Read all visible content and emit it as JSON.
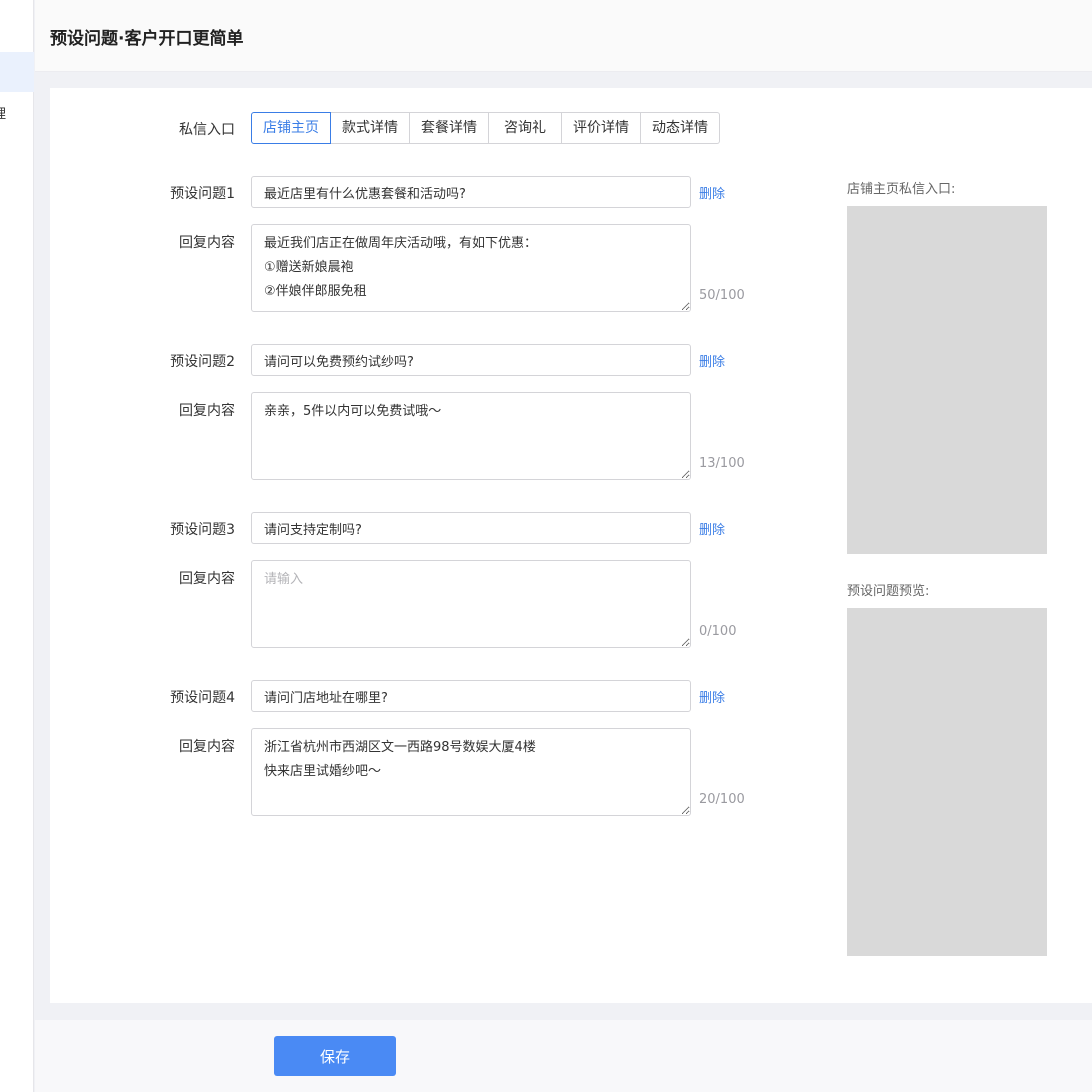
{
  "sidebar": {
    "clipped_item_label": "理"
  },
  "header": {
    "title": "预设问题·客户开口更简单"
  },
  "entry": {
    "label": "私信入口",
    "tabs": [
      {
        "label": "店铺主页",
        "active": true
      },
      {
        "label": "款式详情",
        "active": false
      },
      {
        "label": "套餐详情",
        "active": false
      },
      {
        "label": "咨询礼",
        "active": false
      },
      {
        "label": "评价详情",
        "active": false
      },
      {
        "label": "动态详情",
        "active": false
      }
    ]
  },
  "questions": [
    {
      "label": "预设问题1",
      "value": "最近店里有什么优惠套餐和活动吗?",
      "delete_label": "删除",
      "reply_label": "回复内容",
      "reply_value": "最近我们店正在做周年庆活动哦，有如下优惠：\n①赠送新娘晨袍\n②伴娘伴郎服免租",
      "reply_placeholder": "请输入",
      "counter": "50/100"
    },
    {
      "label": "预设问题2",
      "value": "请问可以免费预约试纱吗?",
      "delete_label": "删除",
      "reply_label": "回复内容",
      "reply_value": "亲亲，5件以内可以免费试哦～",
      "reply_placeholder": "请输入",
      "counter": "13/100"
    },
    {
      "label": "预设问题3",
      "value": "请问支持定制吗?",
      "delete_label": "删除",
      "reply_label": "回复内容",
      "reply_value": "",
      "reply_placeholder": "请输入",
      "counter": "0/100"
    },
    {
      "label": "预设问题4",
      "value": "请问门店地址在哪里?",
      "delete_label": "删除",
      "reply_label": "回复内容",
      "reply_value": "浙江省杭州市西湖区文一西路98号数娱大厦4楼\n快来店里试婚纱吧～",
      "reply_placeholder": "请输入",
      "counter": "20/100"
    }
  ],
  "preview": {
    "entry_label": "店铺主页私信入口:",
    "questions_label": "预设问题预览:"
  },
  "footer": {
    "save_label": "保存"
  },
  "colors": {
    "accent": "#3a7de6",
    "button": "#4a8af4",
    "placeholder_box": "#d9d9d9",
    "background": "#f0f1f5"
  }
}
